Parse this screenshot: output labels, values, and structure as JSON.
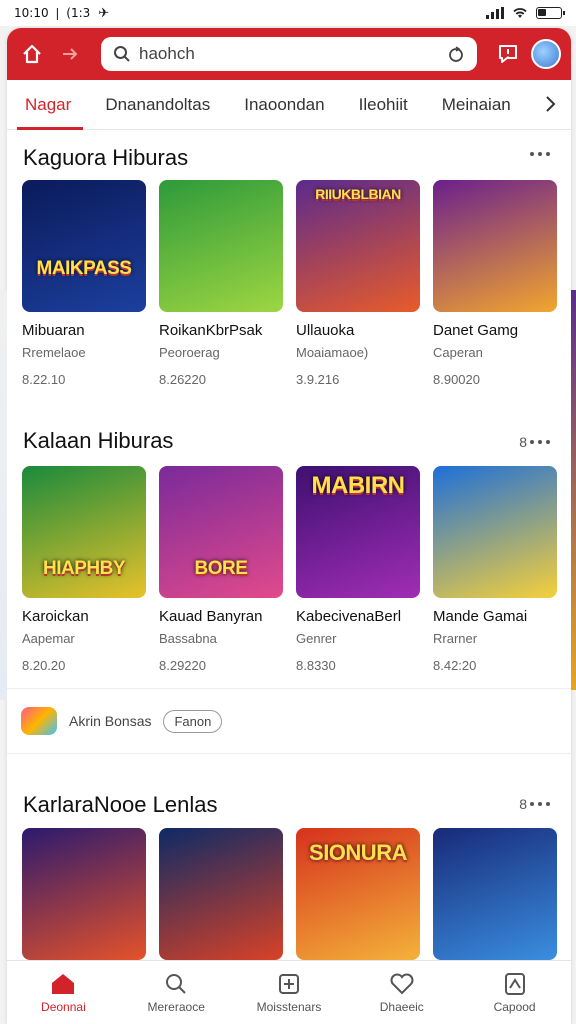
{
  "status": {
    "time": "10:10 ❘ (1:3",
    "nav_glyph": "✈"
  },
  "header": {
    "search_placeholder": "haohch"
  },
  "tabs": [
    "Nagar",
    "Dnanandoltas",
    "Inaoondan",
    "Ileohiit",
    "Meinaian"
  ],
  "sections": [
    {
      "title": "Kaguora Hiburas",
      "more": "",
      "cards": [
        {
          "thumb_text": "MAIKPASS",
          "title": "Mibuaran",
          "sub": "Rremelaoe",
          "meta": "8.22.10",
          "colors": [
            "#0b1a5a",
            "#1c3f9e"
          ]
        },
        {
          "thumb_text": "",
          "title": "RoikanKbrPsak",
          "sub": "Peoroerag",
          "meta": "8.26220",
          "colors": [
            "#2d9a3a",
            "#9ed642"
          ]
        },
        {
          "thumb_text": "RIIUKBLBIAN",
          "title": "Ullauoka",
          "sub": "Moaiamaoe)",
          "meta": "3.9.216",
          "colors": [
            "#5b2a8c",
            "#e85c2a"
          ]
        },
        {
          "thumb_text": "",
          "title": "Danet Gamg",
          "sub": "Caperan",
          "meta": "8.90020",
          "colors": [
            "#6a1f8d",
            "#f2a62e"
          ]
        }
      ]
    },
    {
      "title": "Kalaan Hiburas",
      "more": "8",
      "cards": [
        {
          "thumb_text": "HIAPHBY",
          "title": "Karoickan",
          "sub": "Aapemar",
          "meta": "8.20.20",
          "colors": [
            "#1a8a3c",
            "#e8c22a"
          ]
        },
        {
          "thumb_text": "BORE",
          "title": "Kauad Banyran",
          "sub": "Bassabna",
          "meta": "8.29220",
          "colors": [
            "#7a2a9a",
            "#e24a8c"
          ]
        },
        {
          "thumb_text": "MABIRN",
          "title": "KabecivenaBerl",
          "sub": "Genrer",
          "meta": "8.8330",
          "colors": [
            "#3d1070",
            "#a12db5"
          ]
        },
        {
          "thumb_text": "",
          "title": "Mande Gamai",
          "sub": "Rrarner",
          "meta": "8.42:20",
          "colors": [
            "#1e6fd9",
            "#f6d03a"
          ]
        }
      ]
    },
    {
      "title": "KarlaraNooe Lenlas",
      "more": "8",
      "cards": [
        {
          "thumb_text": "",
          "title": "",
          "sub": "",
          "meta": "",
          "colors": [
            "#2b1a6e",
            "#e5522a"
          ]
        },
        {
          "thumb_text": "",
          "title": "",
          "sub": "",
          "meta": "",
          "colors": [
            "#0d2a66",
            "#d84227"
          ]
        },
        {
          "thumb_text": "SIONURA",
          "title": "",
          "sub": "",
          "meta": "",
          "colors": [
            "#d6321d",
            "#f4b23a"
          ]
        },
        {
          "thumb_text": "",
          "title": "",
          "sub": "",
          "meta": "",
          "colors": [
            "#182a78",
            "#3a8ee0"
          ]
        }
      ]
    }
  ],
  "promo": {
    "text": "Akrin Bonsas",
    "pill": "Fanon"
  },
  "bottom_nav": [
    {
      "label": "Deonnai",
      "icon": "home-icon"
    },
    {
      "label": "Mereraoce",
      "icon": "search-icon"
    },
    {
      "label": "Moisstenars",
      "icon": "calendar-icon"
    },
    {
      "label": "Dhaeeic",
      "icon": "heart-icon"
    },
    {
      "label": "Capood",
      "icon": "profile-icon"
    }
  ],
  "accent": "#d3232a"
}
